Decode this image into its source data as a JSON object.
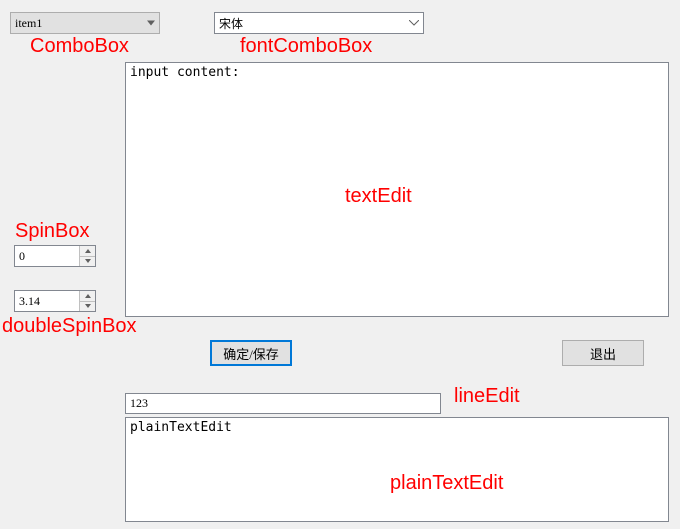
{
  "comboBox": {
    "selected": "item1"
  },
  "fontComboBox": {
    "selected": "宋体"
  },
  "spinBox": {
    "value": "0"
  },
  "doubleSpinBox": {
    "value": "3.14"
  },
  "textEdit": {
    "content": "input content:"
  },
  "lineEdit": {
    "value": "123"
  },
  "plainTextEdit": {
    "content": "plainTextEdit"
  },
  "buttons": {
    "confirm": "确定/保存",
    "exit": "退出"
  },
  "annotations": {
    "comboBox": "ComboBox",
    "fontComboBox": "fontComboBox",
    "spinBox": "SpinBox",
    "doubleSpinBox": "doubleSpinBox",
    "textEdit": "textEdit",
    "lineEdit": "lineEdit",
    "plainTextEdit": "plainTextEdit"
  }
}
